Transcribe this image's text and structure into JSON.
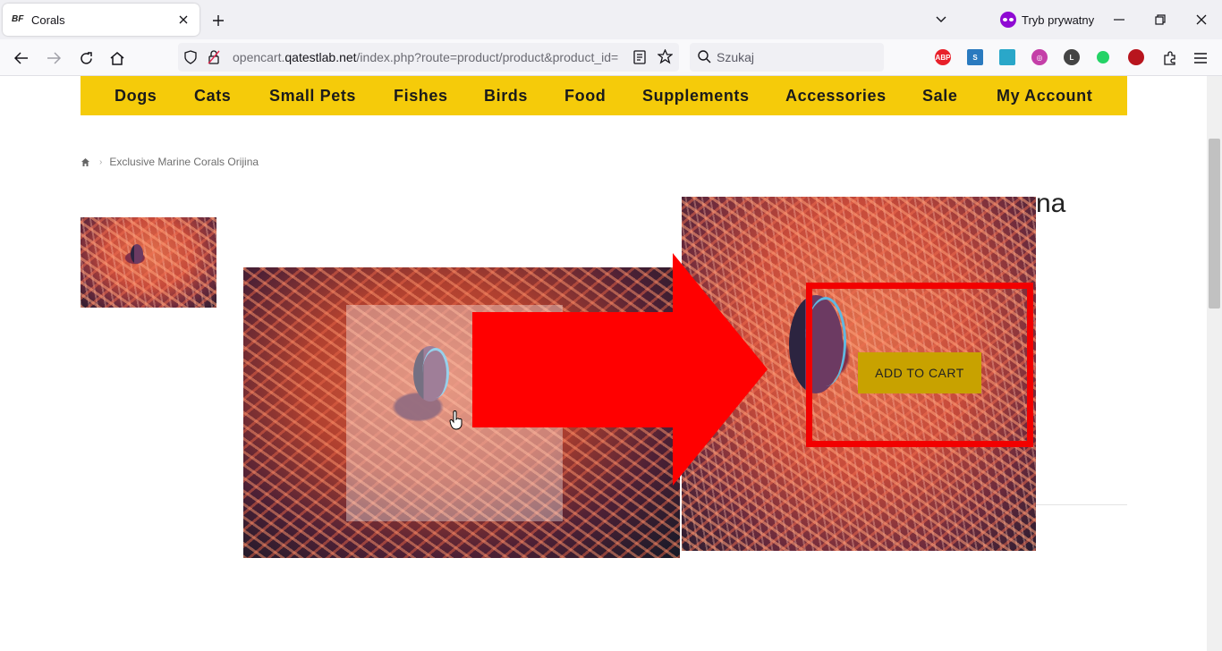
{
  "browser": {
    "tab_title": "Corals",
    "tab_favicon": "BF",
    "private_label": "Tryb prywatny",
    "url_prefix": "opencart.",
    "url_domain": "qatestlab.net",
    "url_path": "/index.php?route=product/product&product_id=",
    "search_placeholder": "Szukaj",
    "extensions": [
      {
        "name": "abp-icon",
        "label": "ABP",
        "color": "#e8202a"
      },
      {
        "name": "extension-s-icon",
        "label": "S",
        "color": "#2a7abf"
      },
      {
        "name": "save-icon",
        "label": "",
        "color": "#2aa7c9"
      },
      {
        "name": "extension-circle-icon",
        "label": "◎",
        "color": "#c43fa8"
      },
      {
        "name": "extension-l-icon",
        "label": "L",
        "color": "#444"
      },
      {
        "name": "whatsapp-icon",
        "label": "",
        "color": "#25d366"
      },
      {
        "name": "extension-dark-icon",
        "label": "",
        "color": "#b8151e"
      }
    ]
  },
  "site": {
    "menu": [
      "Dogs",
      "Cats",
      "Small Pets",
      "Fishes",
      "Birds",
      "Food",
      "Supplements",
      "Accessories",
      "Sale",
      "My Account"
    ],
    "breadcrumb": "Exclusive Marine Corals Orijina",
    "product_title_visible": "na",
    "add_to_cart": "ADD TO CART"
  },
  "colors": {
    "menu_bg": "#f5cb0a",
    "button_bg": "#c8a200",
    "annotation": "#f20000"
  }
}
